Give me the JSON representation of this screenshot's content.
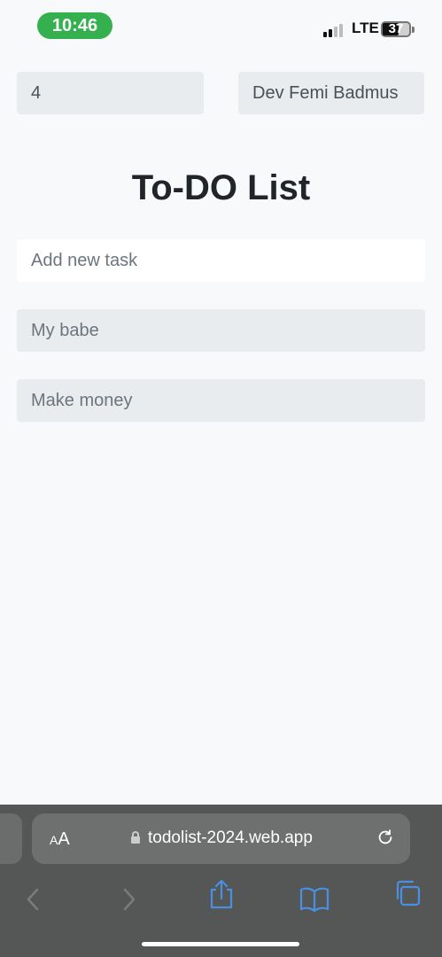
{
  "status": {
    "time": "10:46",
    "network": "LTE",
    "battery": "37"
  },
  "app": {
    "count": "4",
    "author": "Dev Femi Badmus",
    "title": "To-DO List",
    "new_task_placeholder": "Add new task",
    "tasks": [
      {
        "text": "My babe"
      },
      {
        "text": "Make money"
      }
    ]
  },
  "browser": {
    "text_size_label_small": "A",
    "text_size_label_large": "A",
    "url": "todolist-2024.web.app"
  },
  "colors": {
    "time_pill": "#34b14e",
    "browser_bar": "#555656",
    "toolbar_icon_active": "#4a90e2"
  }
}
